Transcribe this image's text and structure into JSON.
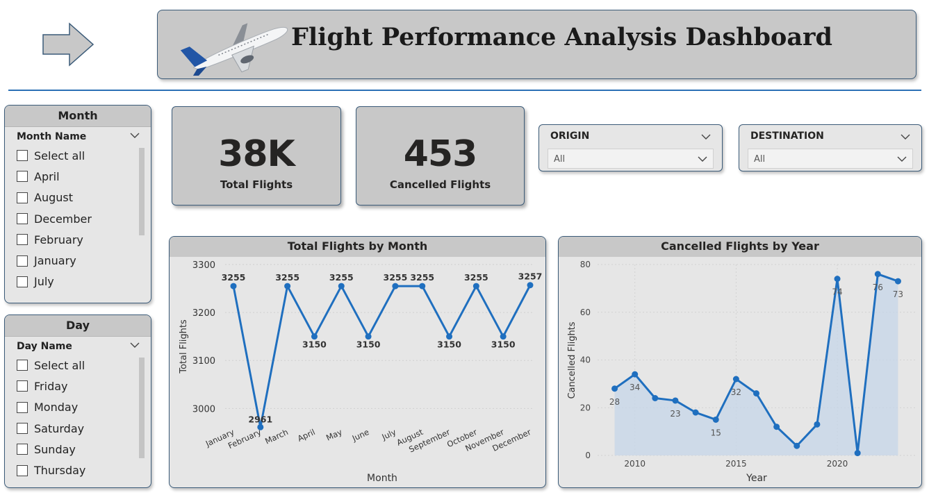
{
  "header": {
    "title": "Flight Performance Analysis Dashboard",
    "icons": {
      "nav": "right-arrow-icon",
      "logo": "airplane-icon"
    }
  },
  "colors": {
    "accent": "#1f6fbf",
    "card_bg": "#c8c8c8",
    "panel_bg": "#e6e6e6",
    "border": "#3a5a78"
  },
  "month_slicer": {
    "title": "Month",
    "field": "Month Name",
    "items": [
      "Select all",
      "April",
      "August",
      "December",
      "February",
      "January",
      "July"
    ]
  },
  "day_slicer": {
    "title": "Day",
    "field": "Day Name",
    "items": [
      "Select all",
      "Friday",
      "Monday",
      "Saturday",
      "Sunday",
      "Thursday"
    ]
  },
  "kpis": {
    "total_flights": {
      "value": "38K",
      "label": "Total Flights"
    },
    "cancelled_flights": {
      "value": "453",
      "label": "Cancelled Flights"
    }
  },
  "filters": {
    "origin": {
      "label": "ORIGIN",
      "value": "All"
    },
    "destination": {
      "label": "DESTINATION",
      "value": "All"
    }
  },
  "chart_data": [
    {
      "type": "line",
      "title": "Total Flights by Month",
      "xlabel": "Month",
      "ylabel": "Total Flights",
      "categories": [
        "January",
        "February",
        "March",
        "April",
        "May",
        "June",
        "July",
        "August",
        "September",
        "October",
        "November",
        "December"
      ],
      "values": [
        3255,
        2961,
        3255,
        3150,
        3255,
        3150,
        3255,
        3255,
        3150,
        3255,
        3150,
        3257
      ],
      "ylim": [
        2960,
        3300
      ],
      "yticks": [
        3000,
        3100,
        3200,
        3300
      ],
      "grid": true,
      "data_labels": true
    },
    {
      "type": "area",
      "title": "Cancelled Flights by Year",
      "xlabel": "Year",
      "ylabel": "Cancelled Flights",
      "x": [
        2009,
        2010,
        2011,
        2012,
        2013,
        2014,
        2015,
        2016,
        2017,
        2018,
        2019,
        2020,
        2021,
        2022,
        2023
      ],
      "values": [
        28,
        34,
        24,
        23,
        18,
        15,
        32,
        26,
        12,
        4,
        13,
        74,
        1,
        76,
        73
      ],
      "labeled": {
        "2009": "28",
        "2010": "34",
        "2012": "23",
        "2014": "15",
        "2015": "32",
        "2020": "74",
        "2022": "76",
        "2023": "73"
      },
      "xticks": [
        2010,
        2015,
        2020
      ],
      "xlim": [
        2008.5,
        2023.5
      ],
      "ylim": [
        0,
        80
      ],
      "yticks": [
        0,
        20,
        40,
        60,
        80
      ],
      "grid": true
    }
  ]
}
